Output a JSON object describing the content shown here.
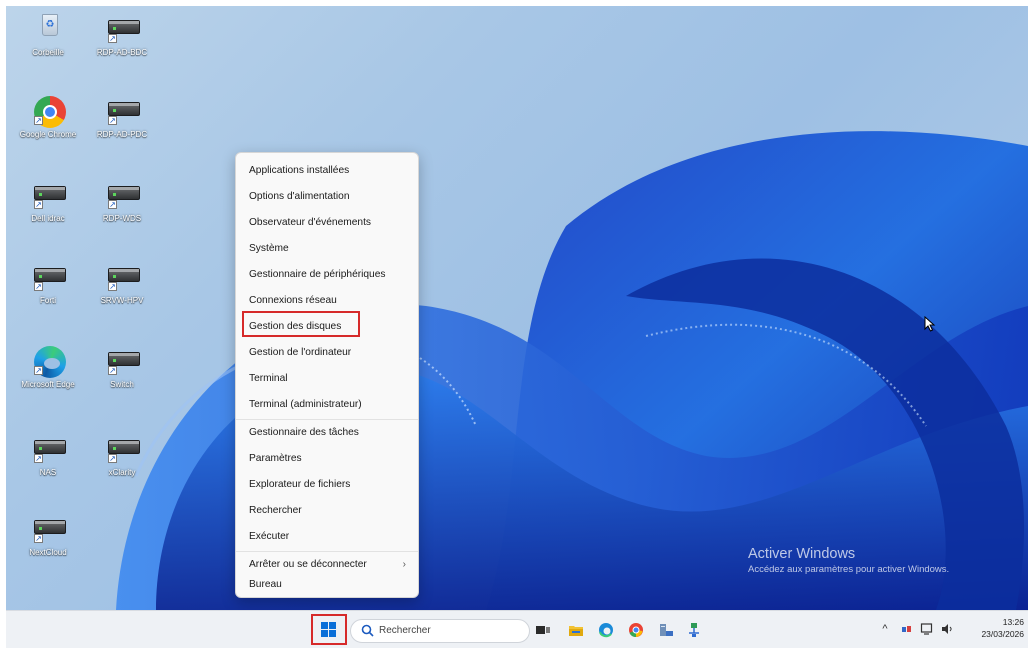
{
  "desktop": {
    "icons": [
      {
        "label": "Corbeille",
        "icon": "recycle-bin-icon"
      },
      {
        "label": "RDP-AD-BDC",
        "icon": "server-icon"
      },
      {
        "label": "Google Chrome",
        "icon": "chrome-icon"
      },
      {
        "label": "RDP-AD-PDC",
        "icon": "server-icon"
      },
      {
        "label": "Dell idrac",
        "icon": "server-icon"
      },
      {
        "label": "RDP-WDS",
        "icon": "server-icon"
      },
      {
        "label": "Forti",
        "icon": "server-icon"
      },
      {
        "label": "SRVW-HPV",
        "icon": "server-icon"
      },
      {
        "label": "Microsoft Edge",
        "icon": "edge-icon"
      },
      {
        "label": "Switch",
        "icon": "server-icon"
      },
      {
        "label": "NAS",
        "icon": "server-icon"
      },
      {
        "label": "xClarity",
        "icon": "server-icon"
      },
      {
        "label": "NextCloud",
        "icon": "server-icon"
      }
    ]
  },
  "context_menu": {
    "items": [
      {
        "label": "Applications installées"
      },
      {
        "label": "Options d'alimentation"
      },
      {
        "label": "Observateur d'événements"
      },
      {
        "label": "Système"
      },
      {
        "label": "Gestionnaire de périphériques"
      },
      {
        "label": "Connexions réseau"
      },
      {
        "label": "Gestion des disques",
        "highlighted": true
      },
      {
        "label": "Gestion de l'ordinateur"
      },
      {
        "label": "Terminal"
      },
      {
        "label": "Terminal (administrateur)"
      },
      {
        "label": "Gestionnaire des tâches"
      },
      {
        "label": "Paramètres"
      },
      {
        "label": "Explorateur de fichiers"
      },
      {
        "label": "Rechercher"
      },
      {
        "label": "Exécuter"
      },
      {
        "label": "Arrêter ou se déconnecter",
        "submenu_arrow": "›"
      },
      {
        "label": "Bureau"
      }
    ]
  },
  "watermark": {
    "title": "Activer Windows",
    "subtitle": "Accédez aux paramètres pour activer Windows."
  },
  "taskbar": {
    "start_icon": "windows-start-icon",
    "search_placeholder": "Rechercher",
    "pinned": [
      "task-view-icon",
      "file-explorer-icon",
      "edge-icon",
      "chrome-icon",
      "server-manager-icon",
      "network-icon"
    ],
    "tray": {
      "chevron": "^",
      "icons": [
        "bluetooth-icon",
        "network-icon",
        "volume-icon"
      ]
    },
    "clock": {
      "time": "13:26",
      "date": "23/03/2026"
    }
  },
  "colors": {
    "accent": "#0a6fd8",
    "highlight": "#d62a2a",
    "menu_bg": "#f9f9f9",
    "taskbar_bg": "#eef1f5"
  }
}
